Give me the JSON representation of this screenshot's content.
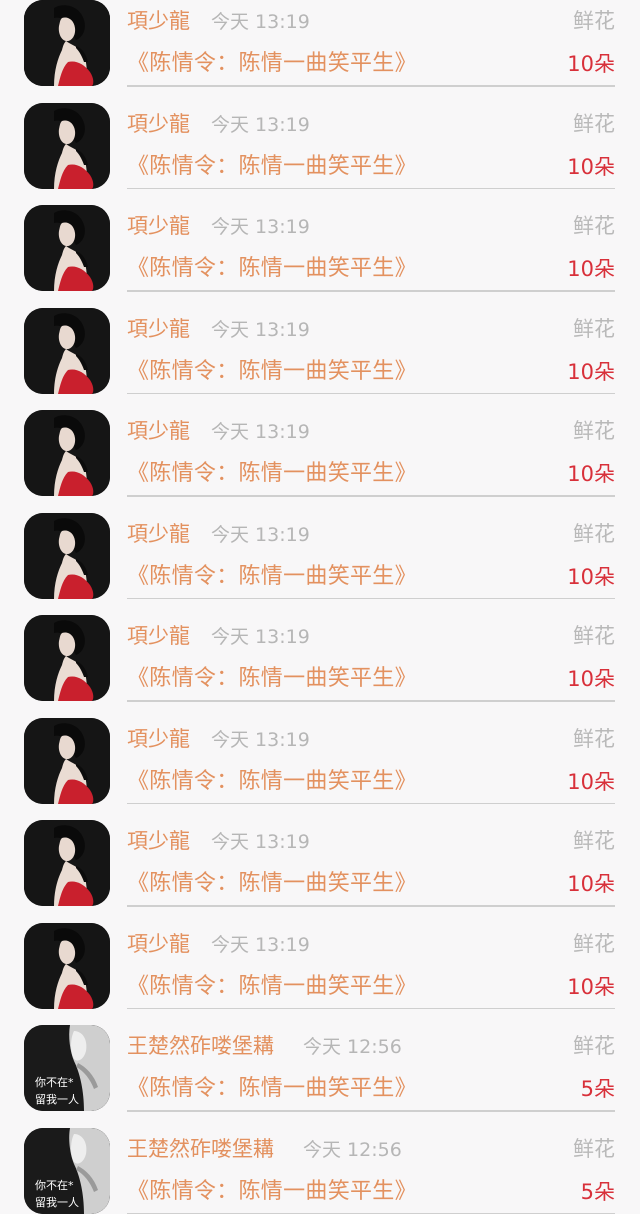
{
  "list": {
    "items": [
      {
        "user": "項少龍",
        "time": "今天 13:19",
        "gift": "鲜花",
        "book": "《陈情令：陈情一曲笑平生》",
        "count": "10朵",
        "avatar": "avatar-woman-red"
      },
      {
        "user": "項少龍",
        "time": "今天 13:19",
        "gift": "鲜花",
        "book": "《陈情令：陈情一曲笑平生》",
        "count": "10朵",
        "avatar": "avatar-woman-red"
      },
      {
        "user": "項少龍",
        "time": "今天 13:19",
        "gift": "鲜花",
        "book": "《陈情令：陈情一曲笑平生》",
        "count": "10朵",
        "avatar": "avatar-woman-red"
      },
      {
        "user": "項少龍",
        "time": "今天 13:19",
        "gift": "鲜花",
        "book": "《陈情令：陈情一曲笑平生》",
        "count": "10朵",
        "avatar": "avatar-woman-red"
      },
      {
        "user": "項少龍",
        "time": "今天 13:19",
        "gift": "鲜花",
        "book": "《陈情令：陈情一曲笑平生》",
        "count": "10朵",
        "avatar": "avatar-woman-red"
      },
      {
        "user": "項少龍",
        "time": "今天 13:19",
        "gift": "鲜花",
        "book": "《陈情令：陈情一曲笑平生》",
        "count": "10朵",
        "avatar": "avatar-woman-red"
      },
      {
        "user": "項少龍",
        "time": "今天 13:19",
        "gift": "鲜花",
        "book": "《陈情令：陈情一曲笑平生》",
        "count": "10朵",
        "avatar": "avatar-woman-red"
      },
      {
        "user": "項少龍",
        "time": "今天 13:19",
        "gift": "鲜花",
        "book": "《陈情令：陈情一曲笑平生》",
        "count": "10朵",
        "avatar": "avatar-woman-red"
      },
      {
        "user": "項少龍",
        "time": "今天 13:19",
        "gift": "鲜花",
        "book": "《陈情令：陈情一曲笑平生》",
        "count": "10朵",
        "avatar": "avatar-woman-red"
      },
      {
        "user": "項少龍",
        "time": "今天 13:19",
        "gift": "鲜花",
        "book": "《陈情令：陈情一曲笑平生》",
        "count": "10朵",
        "avatar": "avatar-woman-red"
      },
      {
        "user": "王楚然砟喽堡耩",
        "time": "今天 12:56",
        "gift": "鲜花",
        "book": "《陈情令：陈情一曲笑平生》",
        "count": "5朵",
        "avatar": "avatar-bw-text",
        "avatar_text": [
          "你不在*",
          "留我一人"
        ]
      },
      {
        "user": "王楚然砟喽堡耩",
        "time": "今天 12:56",
        "gift": "鲜花",
        "book": "《陈情令：陈情一曲笑平生》",
        "count": "5朵",
        "avatar": "avatar-bw-text",
        "avatar_text": [
          "你不在*",
          "留我一人"
        ]
      }
    ]
  },
  "colors": {
    "background": "#f8f7f8",
    "name": "#e3915f",
    "book": "#e3915f",
    "time": "#b6b6b6",
    "gift": "#b9b9b9",
    "count": "#d8303a",
    "divider": "#cfcfcf"
  }
}
